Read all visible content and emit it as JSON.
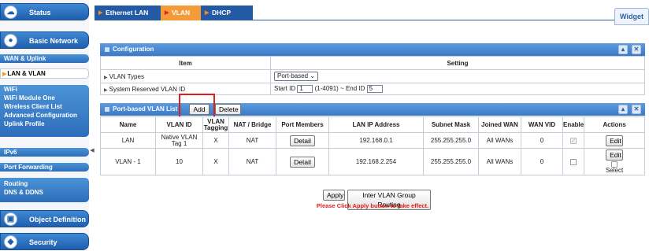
{
  "sidebar": {
    "status": "Status",
    "basic_network": "Basic Network",
    "wan_uplink": "WAN & Uplink",
    "lan_vlan": "LAN & VLAN",
    "wifi_group": [
      "WiFi",
      "WiFi Module One",
      "Wireless Client List",
      "Advanced Configuration",
      "Uplink Profile"
    ],
    "ipv6": "IPv6",
    "port_forwarding": "Port Forwarding",
    "routing_group": [
      "Routing",
      "DNS & DDNS"
    ],
    "object_definition": "Object Definition",
    "security": "Security",
    "collapse_glyph": "◀"
  },
  "tabs": {
    "ethernet_lan": "Ethernet LAN",
    "vlan": "VLAN",
    "dhcp_server": "DHCP Server",
    "widget": "Widget"
  },
  "configuration": {
    "title": "Configuration",
    "col_item": "Item",
    "col_setting": "Setting",
    "vlan_types_label": "VLAN Types",
    "vlan_types_value": "Port-based",
    "reserved_label": "System Reserved VLAN ID",
    "start_id_label": "Start ID",
    "start_id_value": "1",
    "range_hint": "(1-4091) ~ End ID",
    "end_id_value": "5"
  },
  "vlan_list": {
    "title": "Port-based VLAN List",
    "add_label": "Add",
    "delete_label": "Delete",
    "headers": [
      "Name",
      "VLAN ID",
      "VLAN Tagging",
      "NAT / Bridge",
      "Port Members",
      "LAN IP Address",
      "Subnet Mask",
      "Joined WAN",
      "WAN VID",
      "Enable",
      "Actions"
    ],
    "rows": [
      {
        "name": "LAN",
        "vlan_id": "Native VLAN Tag 1",
        "tagging": "X",
        "nat": "NAT",
        "port_members": "Detail",
        "ip": "192.168.0.1",
        "mask": "255.255.255.0",
        "joined_wan": "All WANs",
        "wan_vid": "0",
        "enabled": true,
        "action": "Edit"
      },
      {
        "name": "VLAN - 1",
        "vlan_id": "10",
        "tagging": "X",
        "nat": "NAT",
        "port_members": "Detail",
        "ip": "192.168.2.254",
        "mask": "255.255.255.0",
        "joined_wan": "All WANs",
        "wan_vid": "0",
        "enabled": false,
        "action": "Edit",
        "select_label": "Select"
      }
    ]
  },
  "footer": {
    "apply_label": "Apply",
    "inter_vlan_label": "Inter VLAN Group Routing",
    "notice": "Please Click Apply button to take effect."
  },
  "colors": {
    "accent_blue": "#235aa3",
    "active_tab": "#f29b38",
    "highlight_red": "#d9201c",
    "notice_red": "#e0201c"
  }
}
